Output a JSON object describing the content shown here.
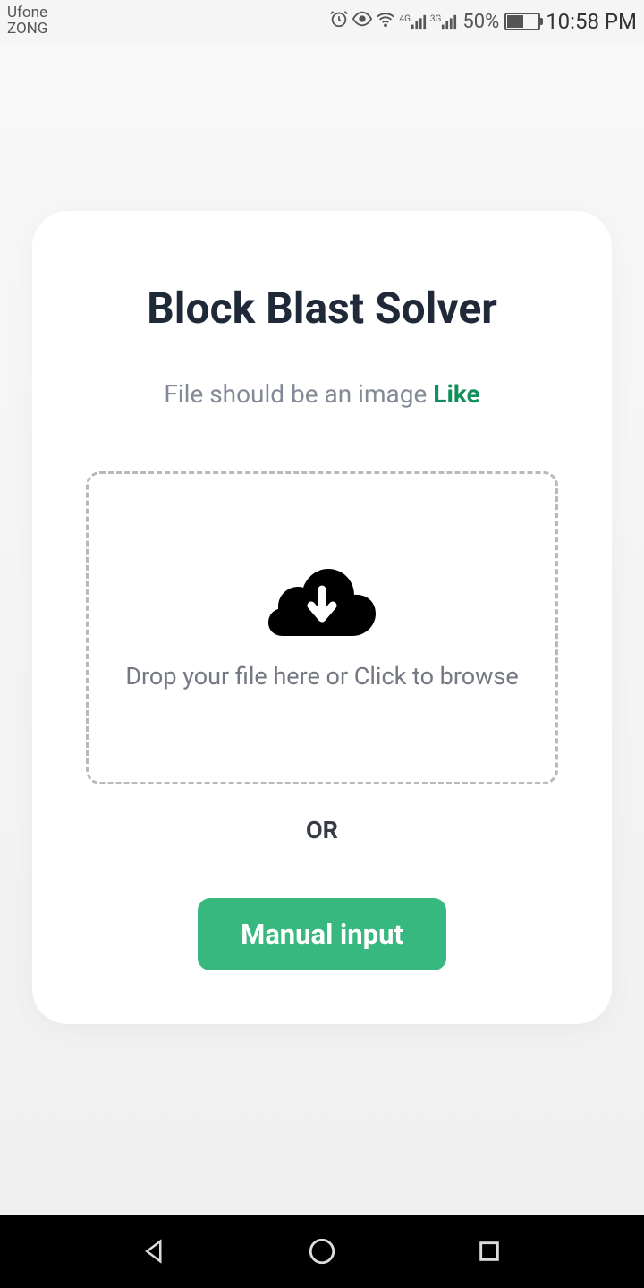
{
  "status_bar": {
    "carrier1": "Ufone",
    "carrier2": "ZONG",
    "signal_type1": "4G",
    "signal_type2": "3G",
    "battery_percent": "50%",
    "time": "10:58 PM"
  },
  "card": {
    "title": "Block Blast Solver",
    "subtitle_prefix": "File should be an image ",
    "subtitle_link": "Like",
    "drop_text": "Drop your file here or Click to browse",
    "separator": "OR",
    "manual_button": "Manual input"
  }
}
